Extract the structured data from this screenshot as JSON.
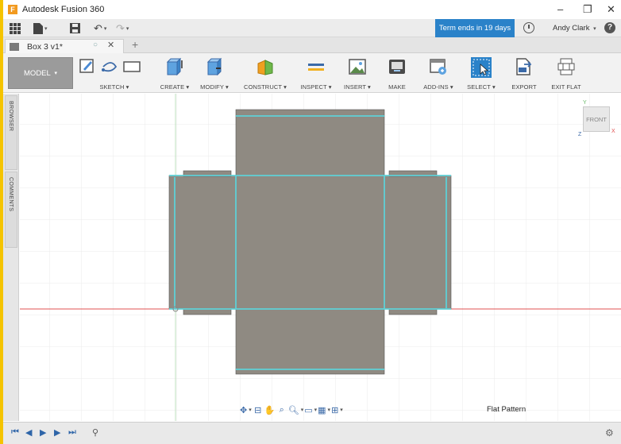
{
  "window": {
    "title": "Autodesk Fusion 360",
    "logo": "F"
  },
  "quick_access": {
    "trial_badge": "Term ends in 19 days",
    "user_name": "Andy Clark",
    "help_label": "?"
  },
  "tabs": {
    "document": "Box 3 v1*"
  },
  "toolbar": {
    "workspace": "MODEL",
    "groups": [
      {
        "label": "SKETCH ▾"
      },
      {
        "label": "CREATE ▾"
      },
      {
        "label": "MODIFY ▾"
      },
      {
        "label": "CONSTRUCT ▾"
      },
      {
        "label": "INSPECT ▾"
      },
      {
        "label": "INSERT ▾"
      },
      {
        "label": "MAKE"
      },
      {
        "label": "ADD-INS ▾"
      },
      {
        "label": "SELECT ▾"
      },
      {
        "label": "EXPORT"
      },
      {
        "label": "EXIT FLAT"
      }
    ]
  },
  "left_panel": {
    "browser": "BROWSER",
    "comments": "COMMENTS"
  },
  "viewcube": {
    "face": "FRONT",
    "axis_x": "X",
    "axis_y": "Y",
    "axis_z": "Z"
  },
  "status": {
    "mode": "Flat Pattern"
  },
  "colors": {
    "accent": "#2a82c9",
    "panel_fill": "#8f8a82",
    "bend_line": "#5ed0d6",
    "axis_red": "#e05050",
    "axis_green": "#66b866"
  }
}
